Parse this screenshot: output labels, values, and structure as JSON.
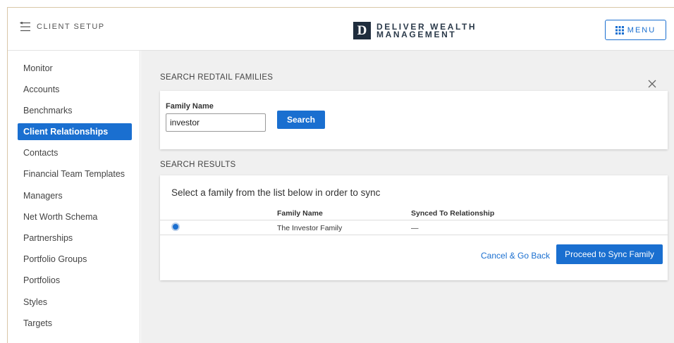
{
  "header": {
    "title": "CLIENT SETUP",
    "brand_mark": "D",
    "brand_line1": "DELIVER WEALTH",
    "brand_line2": "MANAGEMENT",
    "menu_label": "MENU"
  },
  "sidebar": {
    "items": [
      {
        "label": "Monitor",
        "active": false
      },
      {
        "label": "Accounts",
        "active": false
      },
      {
        "label": "Benchmarks",
        "active": false
      },
      {
        "label": "Client Relationships",
        "active": true
      },
      {
        "label": "Contacts",
        "active": false
      },
      {
        "label": "Financial Team Templates",
        "active": false
      },
      {
        "label": "Managers",
        "active": false
      },
      {
        "label": "Net Worth Schema",
        "active": false
      },
      {
        "label": "Partnerships",
        "active": false
      },
      {
        "label": "Portfolio Groups",
        "active": false
      },
      {
        "label": "Portfolios",
        "active": false
      },
      {
        "label": "Styles",
        "active": false
      },
      {
        "label": "Targets",
        "active": false
      }
    ]
  },
  "search": {
    "section_title": "SEARCH REDTAIL FAMILIES",
    "field_label": "Family Name",
    "field_value": "investor",
    "button_label": "Search"
  },
  "results": {
    "section_title": "SEARCH RESULTS",
    "instruction": "Select a family from the list below in order to sync",
    "columns": [
      "Family Name",
      "Synced To Relationship"
    ],
    "rows": [
      {
        "family_name": "The Investor Family",
        "synced": "—",
        "selected": true
      }
    ],
    "cancel_label": "Cancel & Go Back",
    "proceed_label": "Proceed to Sync Family"
  },
  "colors": {
    "accent": "#1a6fd0",
    "brand_dark": "#1f2d3d",
    "main_bg": "#f0f0f0"
  }
}
